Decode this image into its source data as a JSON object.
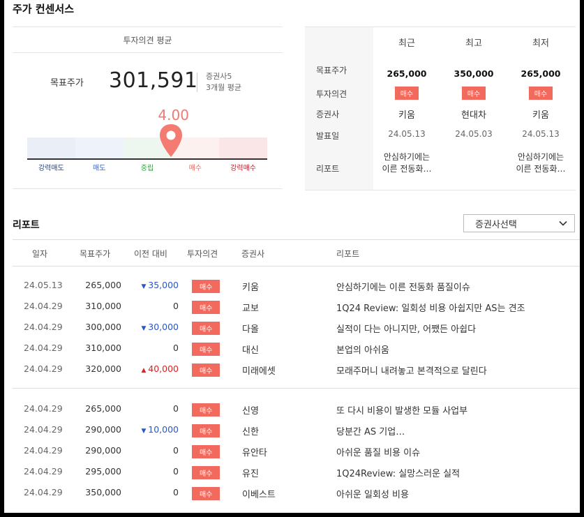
{
  "section_title": "주가 컨센서스",
  "average": {
    "header": "투자의견 평균",
    "target_label": "목표주가",
    "target_value": "301,591",
    "broker_count": "증권사5",
    "period": "3개월 평균",
    "score": "4.00",
    "score_fraction": 0.6,
    "scale": [
      {
        "label": "강력매도",
        "color": "#27447e",
        "bg": "#e9eef7"
      },
      {
        "label": "매도",
        "color": "#3b63b8",
        "bg": "#eef3fb"
      },
      {
        "label": "중립",
        "color": "#3a9a4a",
        "bg": "#eef7ef"
      },
      {
        "label": "매수",
        "color": "#e66a63",
        "bg": "#fdf1f0"
      },
      {
        "label": "강력매수",
        "color": "#c01f2f",
        "bg": "#fbe6e7"
      }
    ]
  },
  "recent": {
    "headers": [
      "최근",
      "최고",
      "최저"
    ],
    "row_labels": [
      "목표주가",
      "투자의견",
      "증권사",
      "발표일",
      "리포트"
    ],
    "columns": [
      {
        "price": "265,000",
        "opinion": "매수",
        "broker": "키움",
        "date": "24.05.13",
        "report_line1": "안심하기에는",
        "report_line2": "이른 전동화…"
      },
      {
        "price": "350,000",
        "opinion": "매수",
        "broker": "현대차",
        "date": "24.05.03",
        "report_line1": "",
        "report_line2": ""
      },
      {
        "price": "265,000",
        "opinion": "매수",
        "broker": "키움",
        "date": "24.05.13",
        "report_line1": "안심하기에는",
        "report_line2": "이른 전동화…"
      }
    ]
  },
  "reports": {
    "title": "리포트",
    "select_label": "증권사선택",
    "columns": [
      "일자",
      "목표주가",
      "이전 대비",
      "투자의견",
      "증권사",
      "리포트"
    ],
    "rows": [
      {
        "date": "24.05.13",
        "price": "265,000",
        "change": "35,000",
        "dir": "down",
        "opinion": "매수",
        "broker": "키움",
        "report": "안심하기에는 이른 전동화 품질이슈"
      },
      {
        "date": "24.04.29",
        "price": "310,000",
        "change": "0",
        "dir": "none",
        "opinion": "매수",
        "broker": "교보",
        "report": "1Q24 Review: 일회성 비용 아쉽지만 AS는 견조"
      },
      {
        "date": "24.04.29",
        "price": "300,000",
        "change": "30,000",
        "dir": "down",
        "opinion": "매수",
        "broker": "다올",
        "report": "실적이 다는 아니지만, 어쨌든 아쉽다"
      },
      {
        "date": "24.04.29",
        "price": "310,000",
        "change": "0",
        "dir": "none",
        "opinion": "매수",
        "broker": "대신",
        "report": "본업의 아쉬움"
      },
      {
        "date": "24.04.29",
        "price": "320,000",
        "change": "40,000",
        "dir": "up",
        "opinion": "매수",
        "broker": "미래에셋",
        "report": "모래주머니 내려놓고 본격적으로 달린다"
      },
      {
        "date": "24.04.29",
        "price": "265,000",
        "change": "0",
        "dir": "none",
        "opinion": "매수",
        "broker": "신영",
        "report": "또 다시 비용이 발생한 모듈 사업부"
      },
      {
        "date": "24.04.29",
        "price": "290,000",
        "change": "10,000",
        "dir": "down",
        "opinion": "매수",
        "broker": "신한",
        "report": "당분간 AS 기업…"
      },
      {
        "date": "24.04.29",
        "price": "290,000",
        "change": "0",
        "dir": "none",
        "opinion": "매수",
        "broker": "유안타",
        "report": "아쉬운 품질 비용 이슈"
      },
      {
        "date": "24.04.29",
        "price": "295,000",
        "change": "0",
        "dir": "none",
        "opinion": "매수",
        "broker": "유진",
        "report": "1Q24Review: 실망스러운 실적"
      },
      {
        "date": "24.04.29",
        "price": "350,000",
        "change": "0",
        "dir": "none",
        "opinion": "매수",
        "broker": "이베스트",
        "report": "아쉬운 일회성 비용"
      }
    ]
  }
}
